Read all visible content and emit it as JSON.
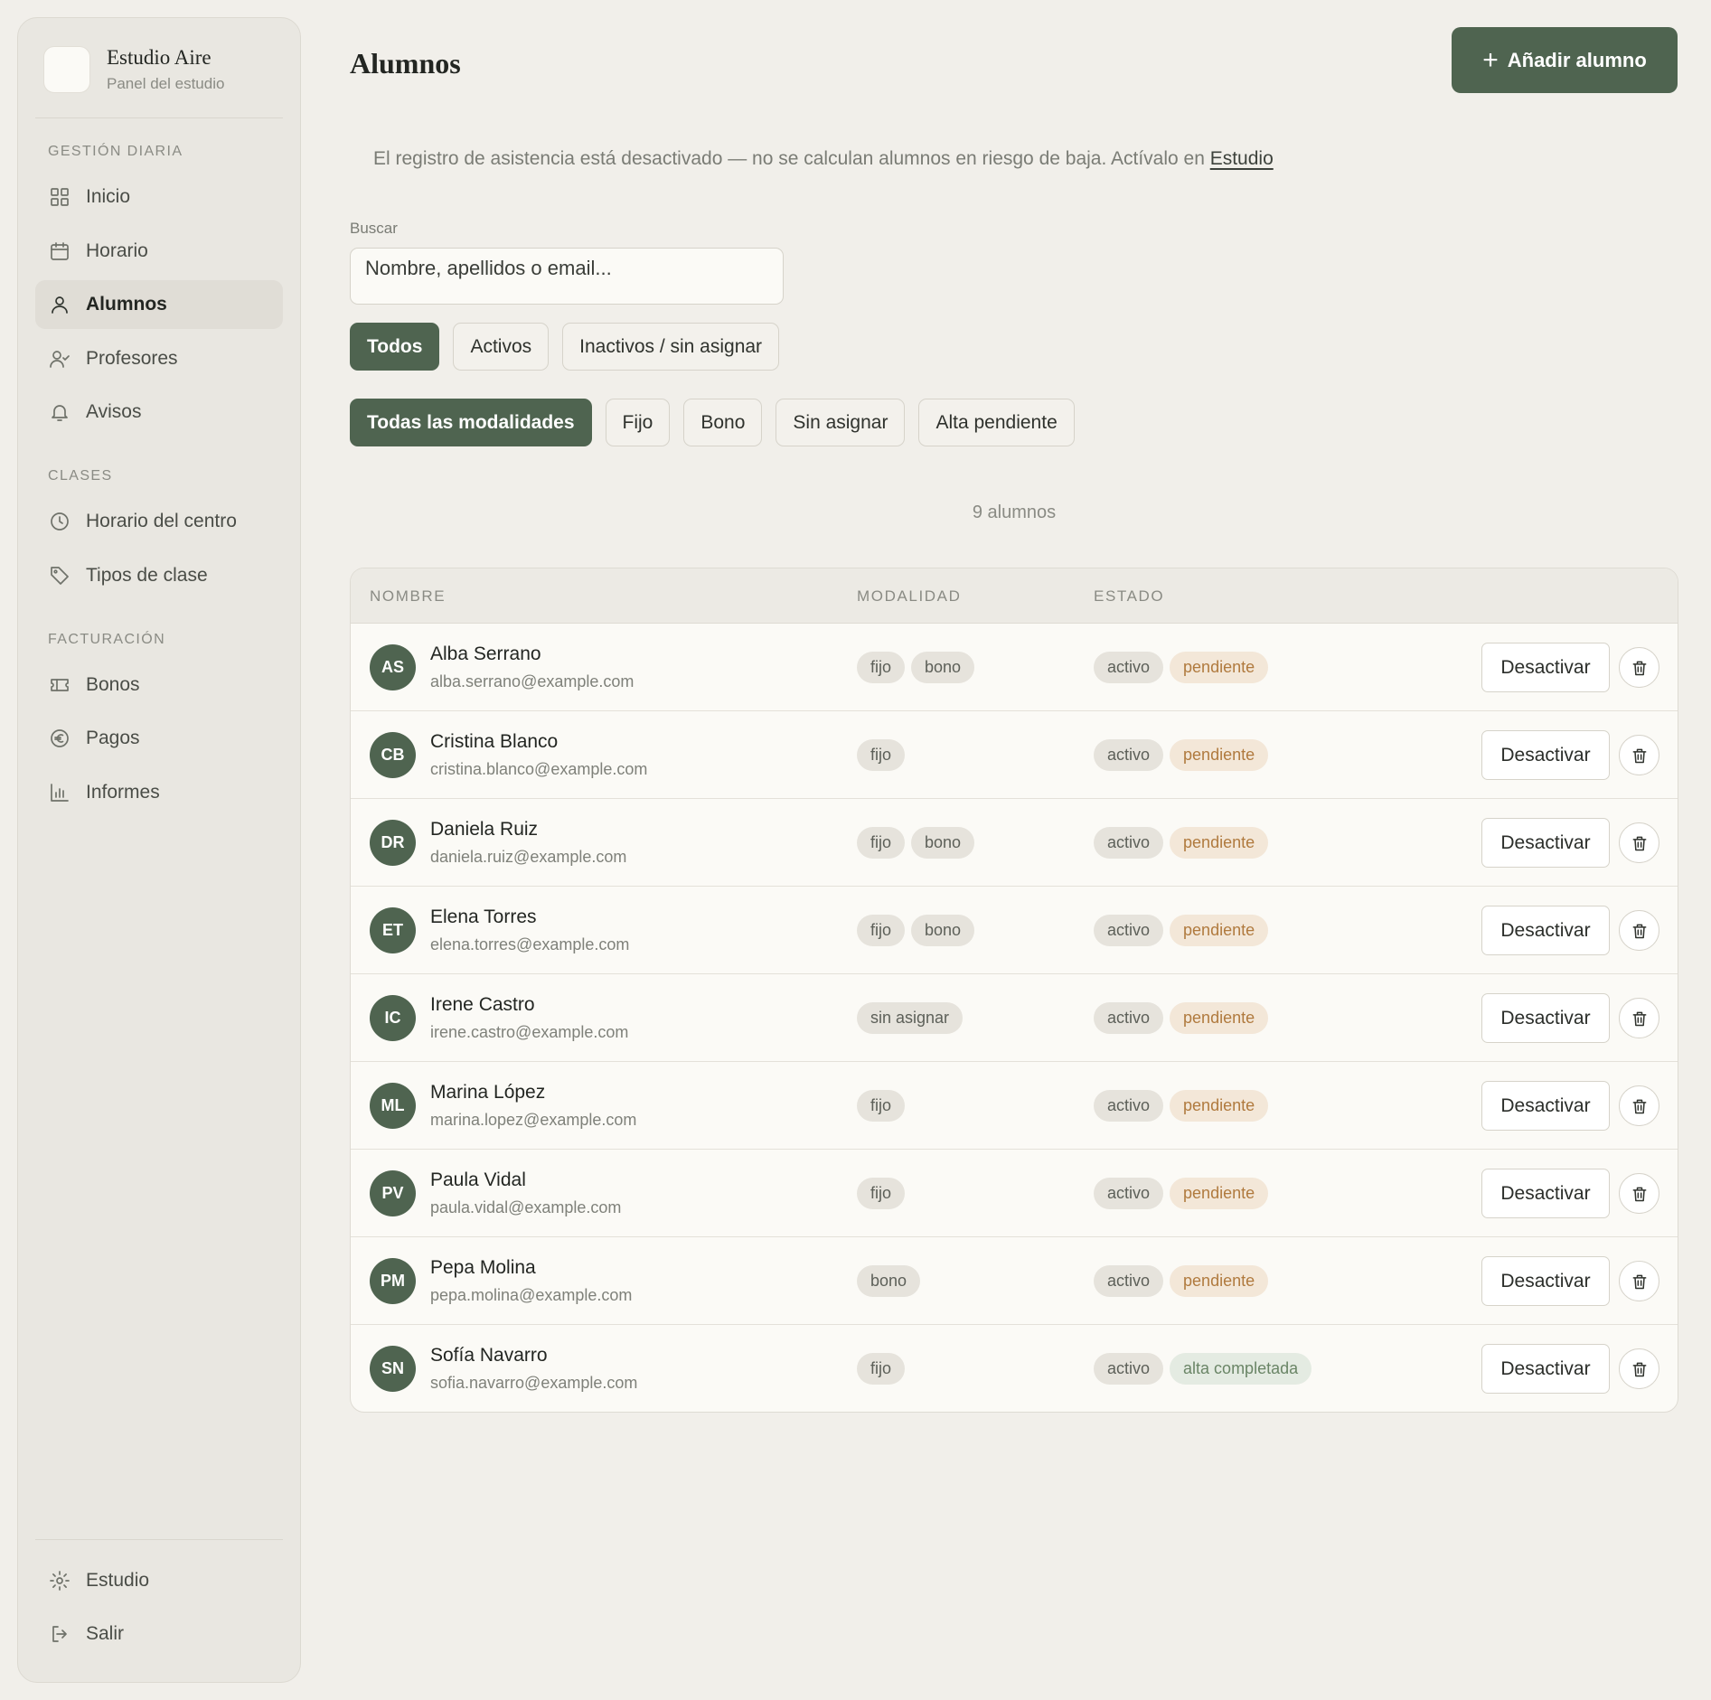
{
  "sidebar": {
    "brand_name": "Estudio Aire",
    "brand_sub": "Panel del estudio",
    "sections": {
      "daily": "GESTIÓN DIARIA",
      "classes": "CLASES",
      "billing": "FACTURACIÓN"
    },
    "items": [
      {
        "label": "Inicio",
        "icon": "grid-icon"
      },
      {
        "label": "Horario",
        "icon": "calendar-icon"
      },
      {
        "label": "Alumnos",
        "icon": "user-icon",
        "active": true
      },
      {
        "label": "Profesores",
        "icon": "user-check-icon"
      },
      {
        "label": "Avisos",
        "icon": "bell-icon"
      },
      {
        "label": "Horario del centro",
        "icon": "clock-icon"
      },
      {
        "label": "Tipos de clase",
        "icon": "tag-icon"
      },
      {
        "label": "Bonos",
        "icon": "ticket-icon"
      },
      {
        "label": "Pagos",
        "icon": "euro-icon"
      },
      {
        "label": "Informes",
        "icon": "bar-chart-icon"
      }
    ],
    "footer": [
      {
        "label": "Estudio",
        "icon": "gear-icon"
      },
      {
        "label": "Salir",
        "icon": "logout-icon"
      }
    ]
  },
  "header": {
    "title": "Alumnos",
    "add_button": "Añadir alumno"
  },
  "notice": {
    "text": "El registro de asistencia está desactivado — no se calculan alumnos en riesgo de baja. Actívalo en ",
    "link": "Estudio"
  },
  "search": {
    "label": "Buscar",
    "placeholder": "Nombre, apellidos o email..."
  },
  "status_filters": [
    "Todos",
    "Activos",
    "Inactivos / sin asignar"
  ],
  "modality_filters": [
    "Todas las modalidades",
    "Fijo",
    "Bono",
    "Sin asignar",
    "Alta pendiente"
  ],
  "count": "9 alumnos",
  "table": {
    "columns": [
      "NOMBRE",
      "MODALIDAD",
      "ESTADO"
    ],
    "deactivate_label": "Desactivar",
    "rows": [
      {
        "initials": "AS",
        "name": "Alba Serrano",
        "email": "alba.serrano@example.com",
        "modalities": [
          "fijo",
          "bono"
        ],
        "status": "activo",
        "signup": "pendiente"
      },
      {
        "initials": "CB",
        "name": "Cristina Blanco",
        "email": "cristina.blanco@example.com",
        "modalities": [
          "fijo"
        ],
        "status": "activo",
        "signup": "pendiente"
      },
      {
        "initials": "DR",
        "name": "Daniela Ruiz",
        "email": "daniela.ruiz@example.com",
        "modalities": [
          "fijo",
          "bono"
        ],
        "status": "activo",
        "signup": "pendiente"
      },
      {
        "initials": "ET",
        "name": "Elena Torres",
        "email": "elena.torres@example.com",
        "modalities": [
          "fijo",
          "bono"
        ],
        "status": "activo",
        "signup": "pendiente"
      },
      {
        "initials": "IC",
        "name": "Irene Castro",
        "email": "irene.castro@example.com",
        "modalities": [
          "sin asignar"
        ],
        "status": "activo",
        "signup": "pendiente"
      },
      {
        "initials": "ML",
        "name": "Marina López",
        "email": "marina.lopez@example.com",
        "modalities": [
          "fijo"
        ],
        "status": "activo",
        "signup": "pendiente"
      },
      {
        "initials": "PV",
        "name": "Paula Vidal",
        "email": "paula.vidal@example.com",
        "modalities": [
          "fijo"
        ],
        "status": "activo",
        "signup": "pendiente"
      },
      {
        "initials": "PM",
        "name": "Pepa Molina",
        "email": "pepa.molina@example.com",
        "modalities": [
          "bono"
        ],
        "status": "activo",
        "signup": "pendiente"
      },
      {
        "initials": "SN",
        "name": "Sofía Navarro",
        "email": "sofia.navarro@example.com",
        "modalities": [
          "fijo"
        ],
        "status": "activo",
        "signup": "alta completada"
      }
    ]
  },
  "colors": {
    "accent": "#4f6450",
    "background": "#f1efea",
    "pending": "#b07a3e",
    "completed": "#6a8566"
  }
}
